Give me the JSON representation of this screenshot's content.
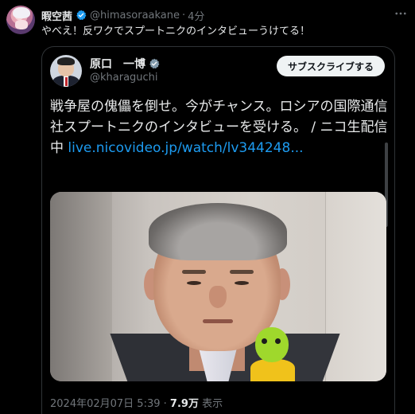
{
  "outer_tweet": {
    "display_name": "暇空茜",
    "handle": "@himasoraakane",
    "separator": "·",
    "time": "4分",
    "text": "やべえ！反ワクでスプートニクのインタビューうけてる！",
    "more_icon": "more-horizontal-icon"
  },
  "quoted_tweet": {
    "display_name": "原口　一博",
    "handle": "@kharaguchi",
    "subscribe_label": "サブスクライブする",
    "body_text": "戦争屋の傀儡を倒せ。今がチャンス。ロシアの国際通信社スプートニクのインタビューを受ける。 / ニコ生配信中 ",
    "link_text": "live.nicovideo.jp/watch/lv344248...",
    "date": "2024年02月07日 5:39",
    "separator": "·",
    "views_count": "7.9万",
    "views_label": "表示"
  },
  "colors": {
    "background": "#000000",
    "text": "#e7e9ea",
    "muted": "#71767b",
    "link": "#1d9bf0",
    "verified_outer": "#1d9bf0",
    "verified_quoted": "#829aab"
  }
}
